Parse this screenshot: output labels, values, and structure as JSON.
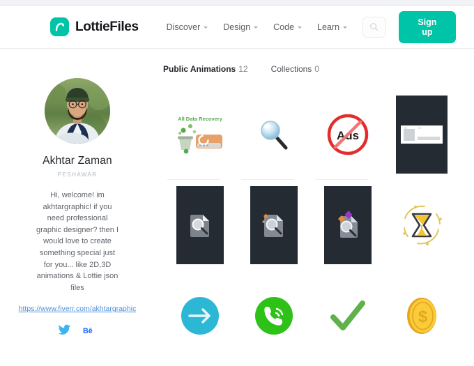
{
  "site": {
    "brand_name": "LottieFiles",
    "brand_icon": "lottie-logo-icon"
  },
  "header": {
    "nav_items": [
      {
        "label": "Discover",
        "has_caret": true
      },
      {
        "label": "Design",
        "has_caret": true
      },
      {
        "label": "Code",
        "has_caret": true
      },
      {
        "label": "Learn",
        "has_caret": true
      }
    ],
    "search_icon": "search-icon",
    "search_placeholder": "",
    "signup_label": "Sign up",
    "accent_color": "#00c4a7"
  },
  "profile": {
    "avatar_alt": "Akhtar Zaman profile photo",
    "name": "Akhtar Zaman",
    "location": "PESHAWAR",
    "bio": "Hi, welcome! im akhtargraphic! if you need professional graphic designer? then I would love to create something special just for you... like 2D,3D animations & Lottie json files",
    "link": "https://www.fiverr.com/akhtargraphic",
    "link_color": "#4a90d9",
    "socials": [
      {
        "name": "twitter-icon",
        "label": "Twitter",
        "color": "#3cb4f0"
      },
      {
        "name": "behance-icon",
        "label": "Behance",
        "color": "#1769ff"
      }
    ]
  },
  "tabs": [
    {
      "label": "Public Animations",
      "count": "12",
      "active": true
    },
    {
      "label": "Collections",
      "count": "0",
      "active": false
    }
  ],
  "gallery": {
    "items": [
      {
        "name": "all-data-recovery-animation",
        "title": "All Data Recovery",
        "style": "light",
        "icon": "data-recovery-icon"
      },
      {
        "name": "magnifier-animation",
        "title": "",
        "style": "light",
        "icon": "magnifier-icon"
      },
      {
        "name": "no-ads-animation",
        "title": "Ads",
        "style": "light",
        "icon": "no-ads-icon"
      },
      {
        "name": "notification-card-animation",
        "title": "",
        "style": "dark",
        "icon": "notification-card-icon"
      },
      {
        "name": "file-search-gray-animation",
        "title": "",
        "style": "dark",
        "icon": "file-search-icon"
      },
      {
        "name": "file-search-orange-animation",
        "title": "",
        "style": "dark",
        "icon": "file-search-sparkle-icon"
      },
      {
        "name": "file-search-purple-animation",
        "title": "",
        "style": "dark",
        "icon": "file-search-gems-icon"
      },
      {
        "name": "hourglass-animation",
        "title": "",
        "style": "light",
        "icon": "hourglass-icon"
      },
      {
        "name": "arrow-right-animation",
        "title": "",
        "style": "light",
        "icon": "arrow-right-circle-icon"
      },
      {
        "name": "phone-call-animation",
        "title": "",
        "style": "light",
        "icon": "phone-call-icon"
      },
      {
        "name": "checkmark-animation",
        "title": "",
        "style": "light",
        "icon": "checkmark-icon"
      },
      {
        "name": "dollar-coin-animation",
        "title": "",
        "style": "light",
        "icon": "dollar-coin-icon"
      }
    ]
  }
}
